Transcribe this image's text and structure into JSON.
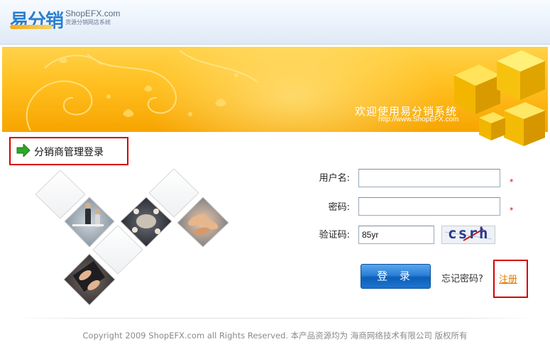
{
  "header": {
    "logo_cn": "易分销",
    "logo_en": "ShopEFX.com",
    "logo_sub": "货源分销网店系统"
  },
  "banner": {
    "welcome": "欢迎使用易分销系统",
    "url": "http://www.ShopEFX.com"
  },
  "section": {
    "title": "分销商管理登录"
  },
  "form": {
    "username_label": "用户名:",
    "password_label": "密码:",
    "captcha_label": "验证码:",
    "username_value": "",
    "password_value": "",
    "captcha_value": "85yr",
    "required_mark": "*",
    "captcha_image_text": "csrh",
    "login_button": "登 录",
    "forgot_password": "忘记密码?",
    "register": "注册"
  },
  "footer": {
    "copyright": "Copyright 2009 ShopEFX.com all Rights Reserved. 本产品资源均为 海商网络技术有限公司  版权所有"
  },
  "colors": {
    "accent_blue": "#2a7fd6",
    "banner_orange": "#ffbf1f",
    "highlight_red": "#d40000",
    "link_orange": "#e07a00"
  }
}
